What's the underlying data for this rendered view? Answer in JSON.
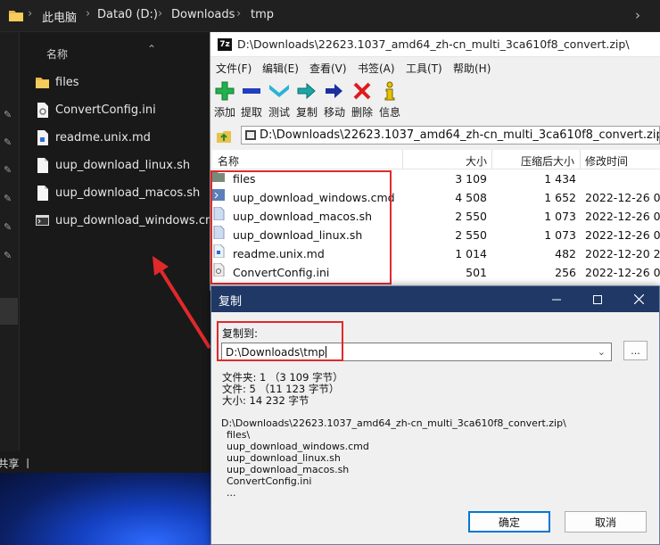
{
  "explorer": {
    "breadcrumb": [
      "此电脑",
      "Data0 (D:)",
      "Downloads",
      "tmp"
    ],
    "column_name": "名称",
    "files": [
      {
        "name": "files",
        "icon": "folder-icon"
      },
      {
        "name": "ConvertConfig.ini",
        "icon": "ini-file-icon"
      },
      {
        "name": "readme.unix.md",
        "icon": "md-file-icon"
      },
      {
        "name": "uup_download_linux.sh",
        "icon": "sh-file-icon"
      },
      {
        "name": "uup_download_macos.sh",
        "icon": "sh-file-icon"
      },
      {
        "name": "uup_download_windows.cmd",
        "icon": "cmd-file-icon"
      }
    ],
    "status": "l共享 丨"
  },
  "zip": {
    "title": "D:\\Downloads\\22623.1037_amd64_zh-cn_multi_3ca610f8_convert.zip\\",
    "menu": [
      "文件(F)",
      "编辑(E)",
      "查看(V)",
      "书签(A)",
      "工具(T)",
      "帮助(H)"
    ],
    "toolbar": [
      "添加",
      "提取",
      "测试",
      "复制",
      "移动",
      "删除",
      "信息"
    ],
    "path": "D:\\Downloads\\22623.1037_amd64_zh-cn_multi_3ca610f8_convert.zip\\",
    "columns": {
      "name": "名称",
      "size": "大小",
      "packed": "压缩后大小",
      "modified": "修改时间"
    },
    "rows": [
      {
        "name": "files",
        "size": "3 109",
        "packed": "1 434",
        "modified": "",
        "icon": "folder-icon"
      },
      {
        "name": "uup_download_windows.cmd",
        "size": "4 508",
        "packed": "1 652",
        "modified": "2022-12-26 0",
        "icon": "cmd-file-icon"
      },
      {
        "name": "uup_download_macos.sh",
        "size": "2 550",
        "packed": "1 073",
        "modified": "2022-12-26 0",
        "icon": "sh-file-icon"
      },
      {
        "name": "uup_download_linux.sh",
        "size": "2 550",
        "packed": "1 073",
        "modified": "2022-12-26 0",
        "icon": "sh-file-icon"
      },
      {
        "name": "readme.unix.md",
        "size": "1 014",
        "packed": "482",
        "modified": "2022-12-20 2",
        "icon": "md-file-icon"
      },
      {
        "name": "ConvertConfig.ini",
        "size": "501",
        "packed": "256",
        "modified": "2022-12-26 0",
        "icon": "ini-file-icon"
      }
    ]
  },
  "dialog": {
    "title": "复制",
    "copy_to_label": "复制到:",
    "destination": "D:\\Downloads\\tmp",
    "browse_label": "...",
    "info": [
      "文件夹: 1  （3 109 字节）",
      "文件: 5  （11 123 字节）",
      "大小: 14 232 字节"
    ],
    "source_path": "D:\\Downloads\\22623.1037_amd64_zh-cn_multi_3ca610f8_convert.zip\\",
    "items": [
      "files\\",
      "uup_download_windows.cmd",
      "uup_download_linux.sh",
      "uup_download_macos.sh",
      "ConvertConfig.ini",
      "..."
    ],
    "ok_label": "确定",
    "cancel_label": "取消"
  },
  "colors": {
    "highlight": "#e0292b",
    "dialog_title": "#1f3866",
    "accent": "#0078d4"
  }
}
